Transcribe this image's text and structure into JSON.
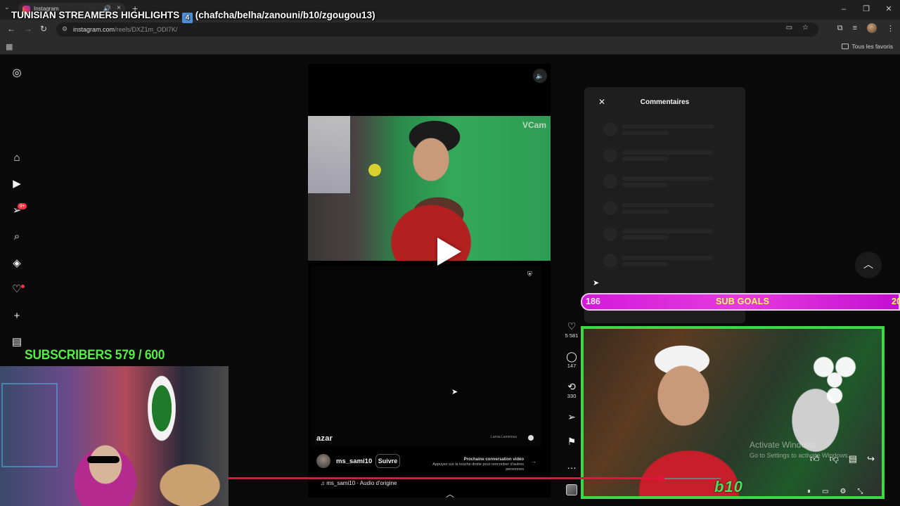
{
  "browser": {
    "tab_label": "Instagram",
    "url_host": "instagram.com",
    "url_path": "/reels/DXZ1m_ODI7K/",
    "bookmarks_label": "Tous les favoris"
  },
  "stream": {
    "title": "TUNISIAN STREAMERS HIGHLIGHTS",
    "title_tags": "(chafcha/belha/zanouni/b10/zgougou13)",
    "subscribers": "SUBSCRIBERS 579 / 600",
    "sub_goal_left": "186",
    "sub_goal_label": "SUB GOALS",
    "sub_goal_right": "20",
    "webcam_logo": "b10"
  },
  "sidebar": {
    "notification_badge": "9+",
    "icons": [
      "instagram-icon",
      "home-icon",
      "reels-icon",
      "messages-icon",
      "search-icon",
      "explore-icon",
      "notifications-icon",
      "create-icon",
      "dashboard-icon"
    ]
  },
  "reel": {
    "video_watermark": "VCam",
    "azar_logo": "azar",
    "azar_right_text": "Lamia Lammous",
    "username": "ms_sami10",
    "follow_label": "Suivre",
    "next_conv_title": "Prochaine conversation vidéo",
    "next_conv_sub": "Appuyez sur la touche droite pour rencontrer d'autres personnes",
    "audio": "ms_sami10 · Audio d'origine",
    "likes": "5 581",
    "comments": "147",
    "reposts": "330"
  },
  "comments_panel": {
    "title": "Commentaires"
  },
  "windows": {
    "activate_title": "Activate Windows",
    "activate_sub": "Go to Settings to activate Windows."
  }
}
